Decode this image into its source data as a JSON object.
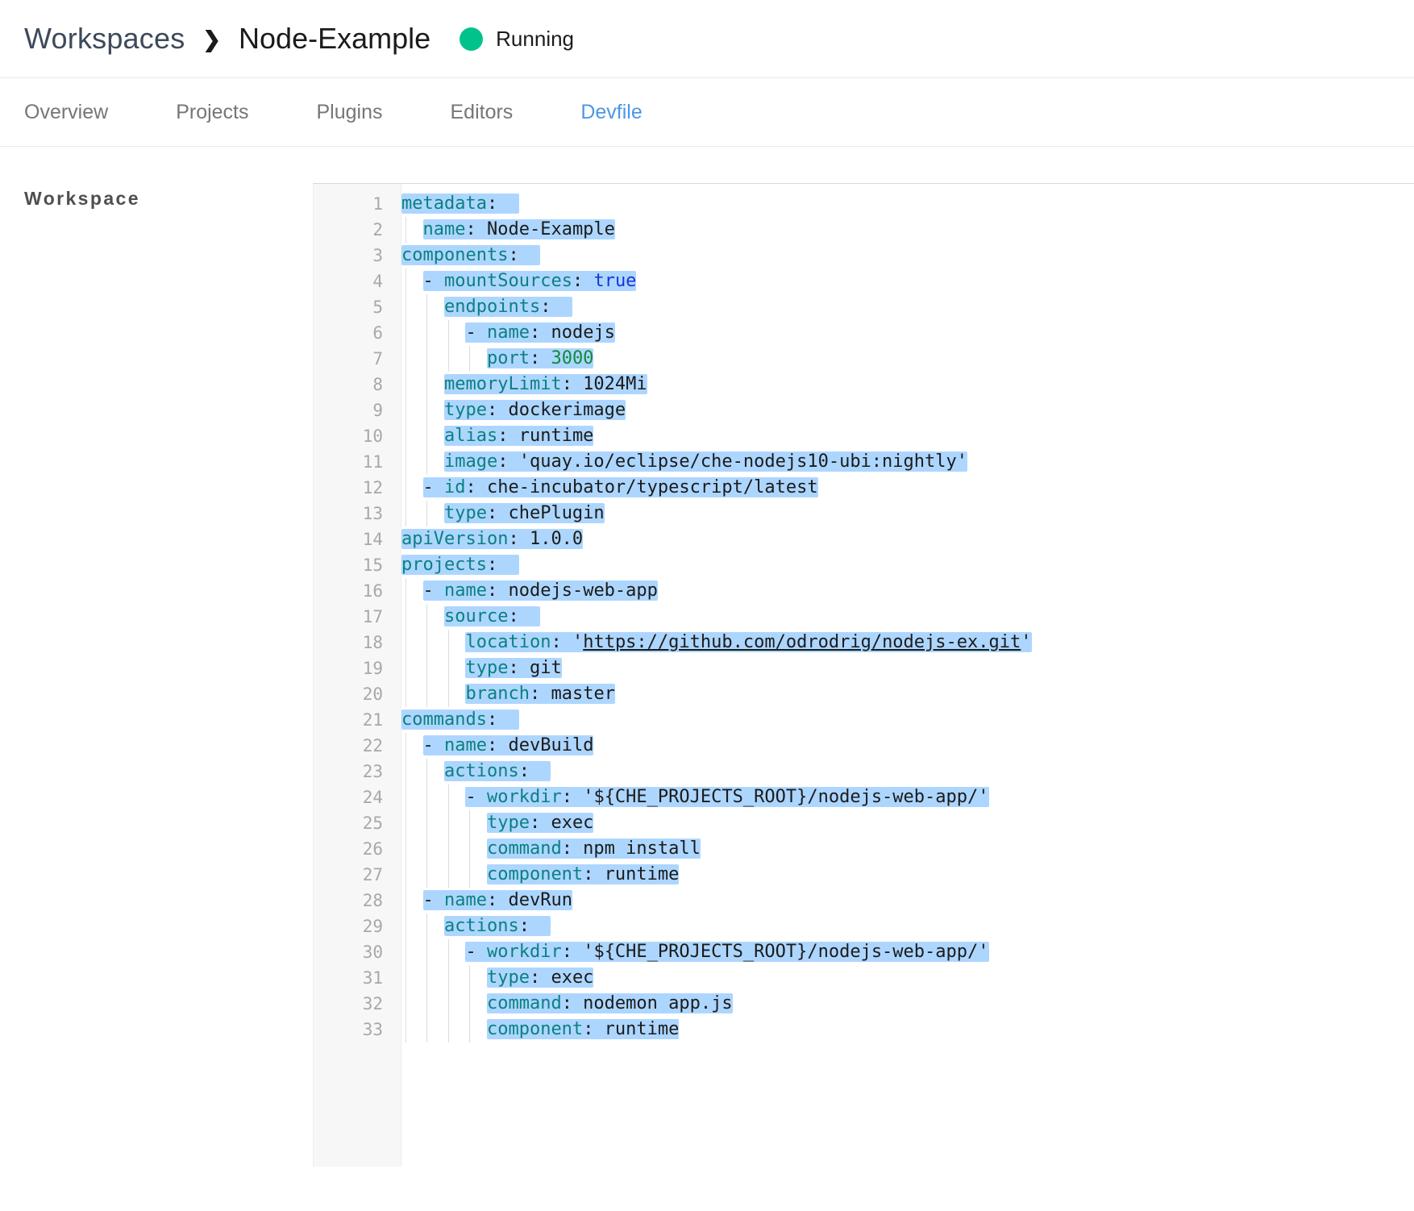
{
  "breadcrumb": {
    "root": "Workspaces",
    "separator": "❯",
    "current": "Node-Example"
  },
  "status": {
    "label": "Running",
    "color": "#00c38b",
    "icon": "status-dot-icon"
  },
  "tabs": [
    {
      "label": "Overview",
      "active": false
    },
    {
      "label": "Projects",
      "active": false
    },
    {
      "label": "Plugins",
      "active": false
    },
    {
      "label": "Editors",
      "active": false
    },
    {
      "label": "Devfile",
      "active": true
    }
  ],
  "section": {
    "label": "Workspace"
  },
  "editor": {
    "total_lines": 33,
    "selected_all": true,
    "colors": {
      "selection": "#add6ff",
      "key": "#0b8080",
      "value": "#1b1b1b",
      "number": "#0f8a3c",
      "boolean": "#1a33d6",
      "gutter_bg": "#f7f7f7",
      "line_number": "#a8a8a8"
    },
    "lines": [
      {
        "n": 1,
        "indent": 0,
        "dash": false,
        "key": "metadata",
        "value": "",
        "type": "none"
      },
      {
        "n": 2,
        "indent": 1,
        "dash": false,
        "key": "name",
        "value": "Node-Example",
        "type": "str"
      },
      {
        "n": 3,
        "indent": 0,
        "dash": false,
        "key": "components",
        "value": "",
        "type": "none"
      },
      {
        "n": 4,
        "indent": 1,
        "dash": true,
        "key": "mountSources",
        "value": "true",
        "type": "bool"
      },
      {
        "n": 5,
        "indent": 2,
        "dash": false,
        "key": "endpoints",
        "value": "",
        "type": "none"
      },
      {
        "n": 6,
        "indent": 3,
        "dash": true,
        "key": "name",
        "value": "nodejs",
        "type": "str"
      },
      {
        "n": 7,
        "indent": 4,
        "dash": false,
        "key": "port",
        "value": "3000",
        "type": "num"
      },
      {
        "n": 8,
        "indent": 2,
        "dash": false,
        "key": "memoryLimit",
        "value": "1024Mi",
        "type": "str"
      },
      {
        "n": 9,
        "indent": 2,
        "dash": false,
        "key": "type",
        "value": "dockerimage",
        "type": "str"
      },
      {
        "n": 10,
        "indent": 2,
        "dash": false,
        "key": "alias",
        "value": "runtime",
        "type": "str"
      },
      {
        "n": 11,
        "indent": 2,
        "dash": false,
        "key": "image",
        "value": "'quay.io/eclipse/che-nodejs10-ubi:nightly'",
        "type": "str"
      },
      {
        "n": 12,
        "indent": 1,
        "dash": true,
        "key": "id",
        "value": "che-incubator/typescript/latest",
        "type": "str"
      },
      {
        "n": 13,
        "indent": 2,
        "dash": false,
        "key": "type",
        "value": "chePlugin",
        "type": "str"
      },
      {
        "n": 14,
        "indent": 0,
        "dash": false,
        "key": "apiVersion",
        "value": "1.0.0",
        "type": "str"
      },
      {
        "n": 15,
        "indent": 0,
        "dash": false,
        "key": "projects",
        "value": "",
        "type": "none"
      },
      {
        "n": 16,
        "indent": 1,
        "dash": true,
        "key": "name",
        "value": "nodejs-web-app",
        "type": "str"
      },
      {
        "n": 17,
        "indent": 2,
        "dash": false,
        "key": "source",
        "value": "",
        "type": "none"
      },
      {
        "n": 18,
        "indent": 3,
        "dash": false,
        "key": "location",
        "value": "'https://github.com/odrodrig/nodejs-ex.git'",
        "type": "link"
      },
      {
        "n": 19,
        "indent": 3,
        "dash": false,
        "key": "type",
        "value": "git",
        "type": "str"
      },
      {
        "n": 20,
        "indent": 3,
        "dash": false,
        "key": "branch",
        "value": "master",
        "type": "str"
      },
      {
        "n": 21,
        "indent": 0,
        "dash": false,
        "key": "commands",
        "value": "",
        "type": "none"
      },
      {
        "n": 22,
        "indent": 1,
        "dash": true,
        "key": "name",
        "value": "devBuild",
        "type": "str"
      },
      {
        "n": 23,
        "indent": 2,
        "dash": false,
        "key": "actions",
        "value": "",
        "type": "none"
      },
      {
        "n": 24,
        "indent": 3,
        "dash": true,
        "key": "workdir",
        "value": "'${CHE_PROJECTS_ROOT}/nodejs-web-app/'",
        "type": "str"
      },
      {
        "n": 25,
        "indent": 4,
        "dash": false,
        "key": "type",
        "value": "exec",
        "type": "str"
      },
      {
        "n": 26,
        "indent": 4,
        "dash": false,
        "key": "command",
        "value": "npm install",
        "type": "str"
      },
      {
        "n": 27,
        "indent": 4,
        "dash": false,
        "key": "component",
        "value": "runtime",
        "type": "str"
      },
      {
        "n": 28,
        "indent": 1,
        "dash": true,
        "key": "name",
        "value": "devRun",
        "type": "str"
      },
      {
        "n": 29,
        "indent": 2,
        "dash": false,
        "key": "actions",
        "value": "",
        "type": "none"
      },
      {
        "n": 30,
        "indent": 3,
        "dash": true,
        "key": "workdir",
        "value": "'${CHE_PROJECTS_ROOT}/nodejs-web-app/'",
        "type": "str"
      },
      {
        "n": 31,
        "indent": 4,
        "dash": false,
        "key": "type",
        "value": "exec",
        "type": "str"
      },
      {
        "n": 32,
        "indent": 4,
        "dash": false,
        "key": "command",
        "value": "nodemon app.js",
        "type": "str"
      },
      {
        "n": 33,
        "indent": 4,
        "dash": false,
        "key": "component",
        "value": "runtime",
        "type": "str"
      }
    ]
  }
}
